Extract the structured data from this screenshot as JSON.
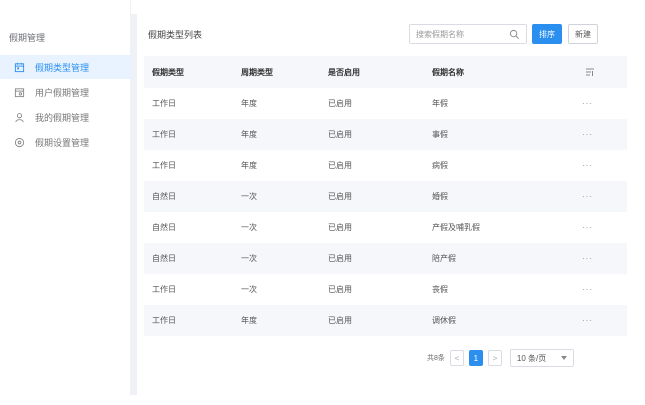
{
  "sidebar": {
    "title": "假期管理",
    "items": [
      {
        "label": "假期类型管理",
        "icon": "calendar-icon",
        "active": true
      },
      {
        "label": "用户假期管理",
        "icon": "user-calendar-icon",
        "active": false
      },
      {
        "label": "我的假期管理",
        "icon": "user-icon",
        "active": false
      },
      {
        "label": "假期设置管理",
        "icon": "settings-circle-icon",
        "active": false
      }
    ]
  },
  "panel": {
    "title": "假期类型列表",
    "search_placeholder": "搜索假期名称",
    "sort_label": "排序",
    "new_label": "新建"
  },
  "table": {
    "headers": [
      "假期类型",
      "周期类型",
      "是否启用",
      "假期名称"
    ],
    "rows": [
      {
        "type": "工作日",
        "period": "年度",
        "enabled": "已启用",
        "name": "年假",
        "more": "···"
      },
      {
        "type": "工作日",
        "period": "年度",
        "enabled": "已启用",
        "name": "事假",
        "more": "···"
      },
      {
        "type": "工作日",
        "period": "年度",
        "enabled": "已启用",
        "name": "病假",
        "more": "···"
      },
      {
        "type": "自然日",
        "period": "一次",
        "enabled": "已启用",
        "name": "婚假",
        "more": "···"
      },
      {
        "type": "自然日",
        "period": "一次",
        "enabled": "已启用",
        "name": "产假及哺乳假",
        "more": "···"
      },
      {
        "type": "自然日",
        "period": "一次",
        "enabled": "已启用",
        "name": "陪产假",
        "more": "···"
      },
      {
        "type": "工作日",
        "period": "一次",
        "enabled": "已启用",
        "name": "丧假",
        "more": "···"
      },
      {
        "type": "工作日",
        "period": "年度",
        "enabled": "已启用",
        "name": "调休假",
        "more": "···"
      }
    ]
  },
  "pagination": {
    "total": "共8条",
    "prev": "<",
    "current": "1",
    "next": ">",
    "page_size": "10 条/页"
  },
  "colors": {
    "accent": "#2b8ff0",
    "active_bg": "#e8f3ff",
    "stripe": "#f5f7fa"
  }
}
